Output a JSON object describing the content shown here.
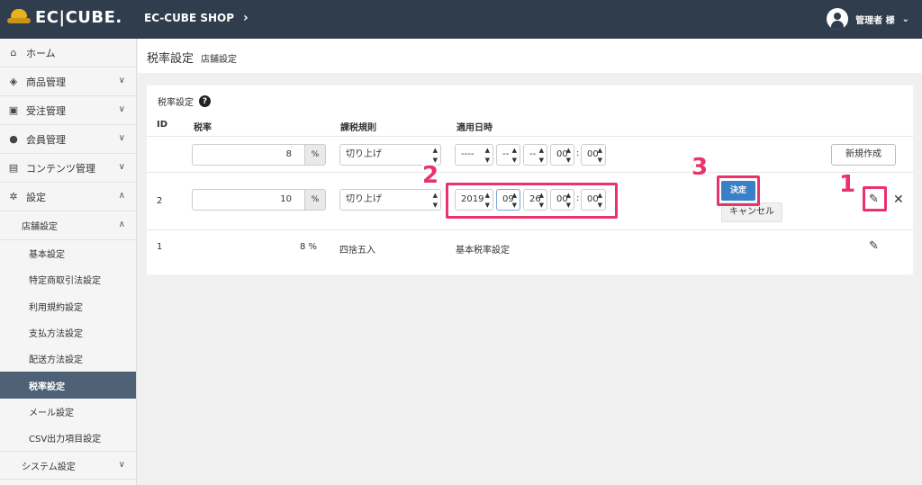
{
  "header": {
    "logo_text": "EC|CUBE.",
    "shop_name": "EC-CUBE SHOP",
    "user_label": "管理者 様"
  },
  "sidebar": {
    "items": [
      {
        "label": "ホーム",
        "icon": "home-icon"
      },
      {
        "label": "商品管理",
        "icon": "box-icon"
      },
      {
        "label": "受注管理",
        "icon": "cart-icon"
      },
      {
        "label": "会員管理",
        "icon": "users-icon"
      },
      {
        "label": "コンテンツ管理",
        "icon": "file-icon"
      },
      {
        "label": "設定",
        "icon": "gear-icon"
      }
    ],
    "store_settings": "店舗設定",
    "sub_items": [
      "基本設定",
      "特定商取引法設定",
      "利用規約設定",
      "支払方法設定",
      "配送方法設定",
      "税率設定",
      "メール設定",
      "CSV出力項目設定"
    ],
    "active_sub": "税率設定",
    "system_settings": "システム設定"
  },
  "page": {
    "title": "税率設定",
    "subtitle": "店舗設定"
  },
  "card": {
    "title": "税率設定",
    "columns": [
      "ID",
      "税率",
      "課税規則",
      "適用日時"
    ],
    "new_row": {
      "rate": "8",
      "unit": "%",
      "rule": "切り上げ",
      "year": "----",
      "month": "--",
      "day": "--",
      "hour": "00",
      "minute": "00",
      "create_button": "新規作成"
    },
    "edit_row": {
      "id": "2",
      "rate": "10",
      "unit": "%",
      "rule": "切り上げ",
      "year": "2019",
      "month": "09",
      "day": "26",
      "hour": "00",
      "minute": "00",
      "ok_button": "決定",
      "cancel_button": "キャンセル"
    },
    "base_row": {
      "id": "1",
      "rate": "8 %",
      "rule": "四捨五入",
      "applied": "基本税率設定"
    }
  },
  "annotations": [
    "1",
    "2",
    "3"
  ],
  "colors": {
    "header_bg": "#2f3d4c",
    "active_nav": "#4e6177",
    "primary": "#3a7fc8",
    "highlight": "#e8336b"
  }
}
